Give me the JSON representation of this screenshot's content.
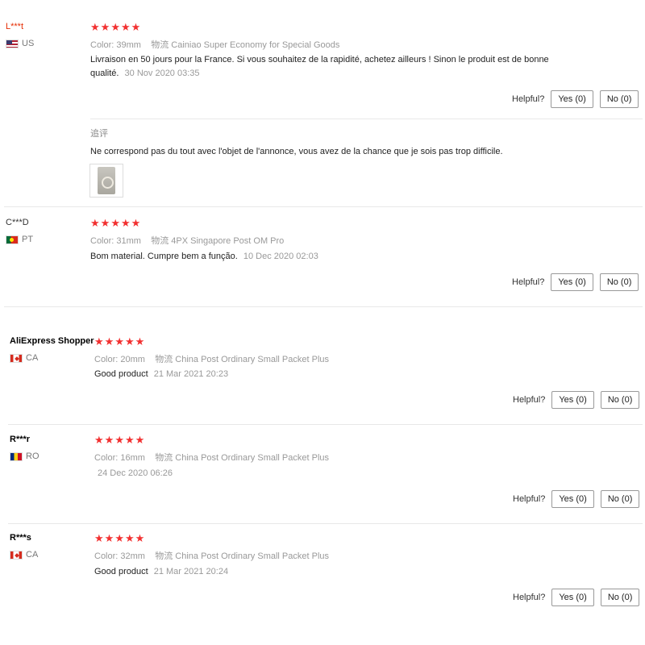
{
  "reviews": [
    {
      "user": "L***t",
      "country": "US",
      "rating": 5,
      "color_label": "Color:",
      "color_value": "39mm",
      "shipping_label": "物流",
      "shipping_value": "Cainiao Super Economy for Special Goods",
      "text": "Livraison en 50 jours pour la France. Si vous souhaitez de la rapidité, achetez ailleurs ! Sinon le produit est de bonne qualité.",
      "date": "30 Nov 2020 03:35",
      "helpful_label": "Helpful?",
      "yes_label": "Yes (0)",
      "no_label": "No (0)",
      "additional_label": "追评",
      "additional_text": "Ne correspond pas du tout avec l'objet de l'annonce, vous avez de la chance que je sois pas trop difficile."
    },
    {
      "user": "C***D",
      "country": "PT",
      "rating": 5,
      "color_label": "Color:",
      "color_value": "31mm",
      "shipping_label": "物流",
      "shipping_value": "4PX Singapore Post OM Pro",
      "text": "Bom material. Cumpre bem a função.",
      "date": "10 Dec 2020 02:03",
      "helpful_label": "Helpful?",
      "yes_label": "Yes (0)",
      "no_label": "No (0)"
    },
    {
      "user": "AliExpress Shopper",
      "country": "CA",
      "rating": 5,
      "color_label": "Color:",
      "color_value": "20mm",
      "shipping_label": "物流",
      "shipping_value": "China Post Ordinary Small Packet Plus",
      "text": "Good product",
      "date": "21 Mar 2021 20:23",
      "helpful_label": "Helpful?",
      "yes_label": "Yes (0)",
      "no_label": "No (0)"
    },
    {
      "user": "R***r",
      "country": "RO",
      "rating": 5,
      "color_label": "Color:",
      "color_value": "16mm",
      "shipping_label": "物流",
      "shipping_value": "China Post Ordinary Small Packet Plus",
      "text": "",
      "date": "24 Dec 2020 06:26",
      "helpful_label": "Helpful?",
      "yes_label": "Yes (0)",
      "no_label": "No (0)"
    },
    {
      "user": "R***s",
      "country": "CA",
      "rating": 5,
      "color_label": "Color:",
      "color_value": "32mm",
      "shipping_label": "物流",
      "shipping_value": "China Post Ordinary Small Packet Plus",
      "text": "Good product",
      "date": "21 Mar 2021 20:24",
      "helpful_label": "Helpful?",
      "yes_label": "Yes (0)",
      "no_label": "No (0)"
    }
  ],
  "colors": {
    "star": "#f23030",
    "username_highlight": "#e62e04"
  },
  "icons": {
    "star": "star-icon",
    "flag_us": "flag-us-icon",
    "flag_pt": "flag-pt-icon",
    "flag_ca": "flag-ca-icon",
    "flag_ro": "flag-ro-icon"
  }
}
